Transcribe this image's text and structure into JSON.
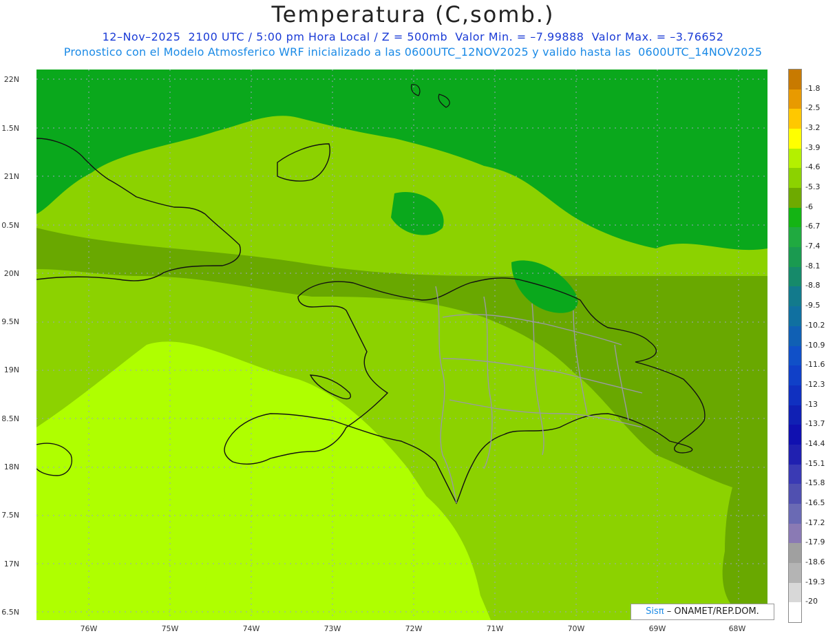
{
  "header": {
    "title": "Temperatura (C,somb.)",
    "line1": "12–Nov–2025  2100 UTC / 5:00 pm Hora Local / Z = 500mb  Valor Min. = –7.99888  Valor Max. = –3.76652",
    "line2": "Pronostico con el Modelo Atmosferico WRF inicializado a las 0600UTC_12NOV2025 y valido hasta las  0600UTC_14NOV2025"
  },
  "axes": {
    "lat_labels": [
      "22N",
      "1.5N",
      "21N",
      "0.5N",
      "20N",
      "9.5N",
      "19N",
      "8.5N",
      "18N",
      "7.5N",
      "17N",
      "6.5N"
    ],
    "lon_labels": [
      "76W",
      "75W",
      "74W",
      "73W",
      "72W",
      "71W",
      "70W",
      "69W",
      "68W"
    ]
  },
  "colorbar": {
    "labels": [
      "-1.8",
      "-2.5",
      "-3.2",
      "-3.9",
      "-4.6",
      "-5.3",
      "-6",
      "-6.7",
      "-7.4",
      "-8.1",
      "-8.8",
      "-9.5",
      "-10.2",
      "-10.9",
      "-11.6",
      "-12.3",
      "-13",
      "-13.7",
      "-14.4",
      "-15.1",
      "-15.8",
      "-16.5",
      "-17.2",
      "-17.9",
      "-18.6",
      "-19.3",
      "-20"
    ],
    "colors": [
      "#c87a00",
      "#e89a00",
      "#ffc800",
      "#ffff00",
      "#b4f000",
      "#8cd200",
      "#6eaa00",
      "#14b414",
      "#20aa40",
      "#1a9a50",
      "#168a6a",
      "#127a8c",
      "#1070a0",
      "#1060b4",
      "#1050c8",
      "#1040c8",
      "#1030c0",
      "#1020b4",
      "#1010b0",
      "#2020b0",
      "#3a3ab4",
      "#5050b0",
      "#6a6ab4",
      "#8a7ab4",
      "#a0a0a0",
      "#b4b4b4",
      "#d8d8d8",
      "#ffffff"
    ]
  },
  "legend_colors": {
    "dark_green": "#0aa81c",
    "mid_green": "#69a800",
    "light_green": "#8cd200",
    "lime": "#afff00",
    "yellow": "#ffff00"
  },
  "logo": {
    "brand": "Sisπ",
    "text": "– ONAMET/REP.DOM."
  }
}
